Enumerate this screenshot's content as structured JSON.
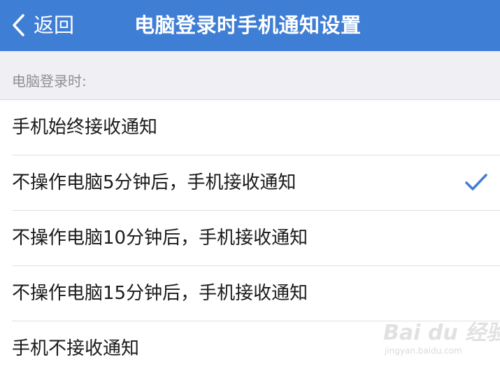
{
  "navbar": {
    "back_label": "返回",
    "title": "电脑登录时手机通知设置",
    "background_color": "#3f7ed5"
  },
  "section": {
    "header_label": "电脑登录时:"
  },
  "options": [
    {
      "label": "手机始终接收通知",
      "selected": false
    },
    {
      "label": "不操作电脑5分钟后，手机接收通知",
      "selected": true
    },
    {
      "label": "不操作电脑10分钟后，手机接收通知",
      "selected": false
    },
    {
      "label": "不操作电脑15分钟后，手机接收通知",
      "selected": false
    },
    {
      "label": "手机不接收通知",
      "selected": false
    }
  ],
  "icons": {
    "back": "chevron-left-icon",
    "selected": "checkmark-icon"
  },
  "accent_color": "#3f7ed5",
  "watermark": {
    "brand": "Bai du 经验",
    "url": "jingyan.baidu.com"
  }
}
